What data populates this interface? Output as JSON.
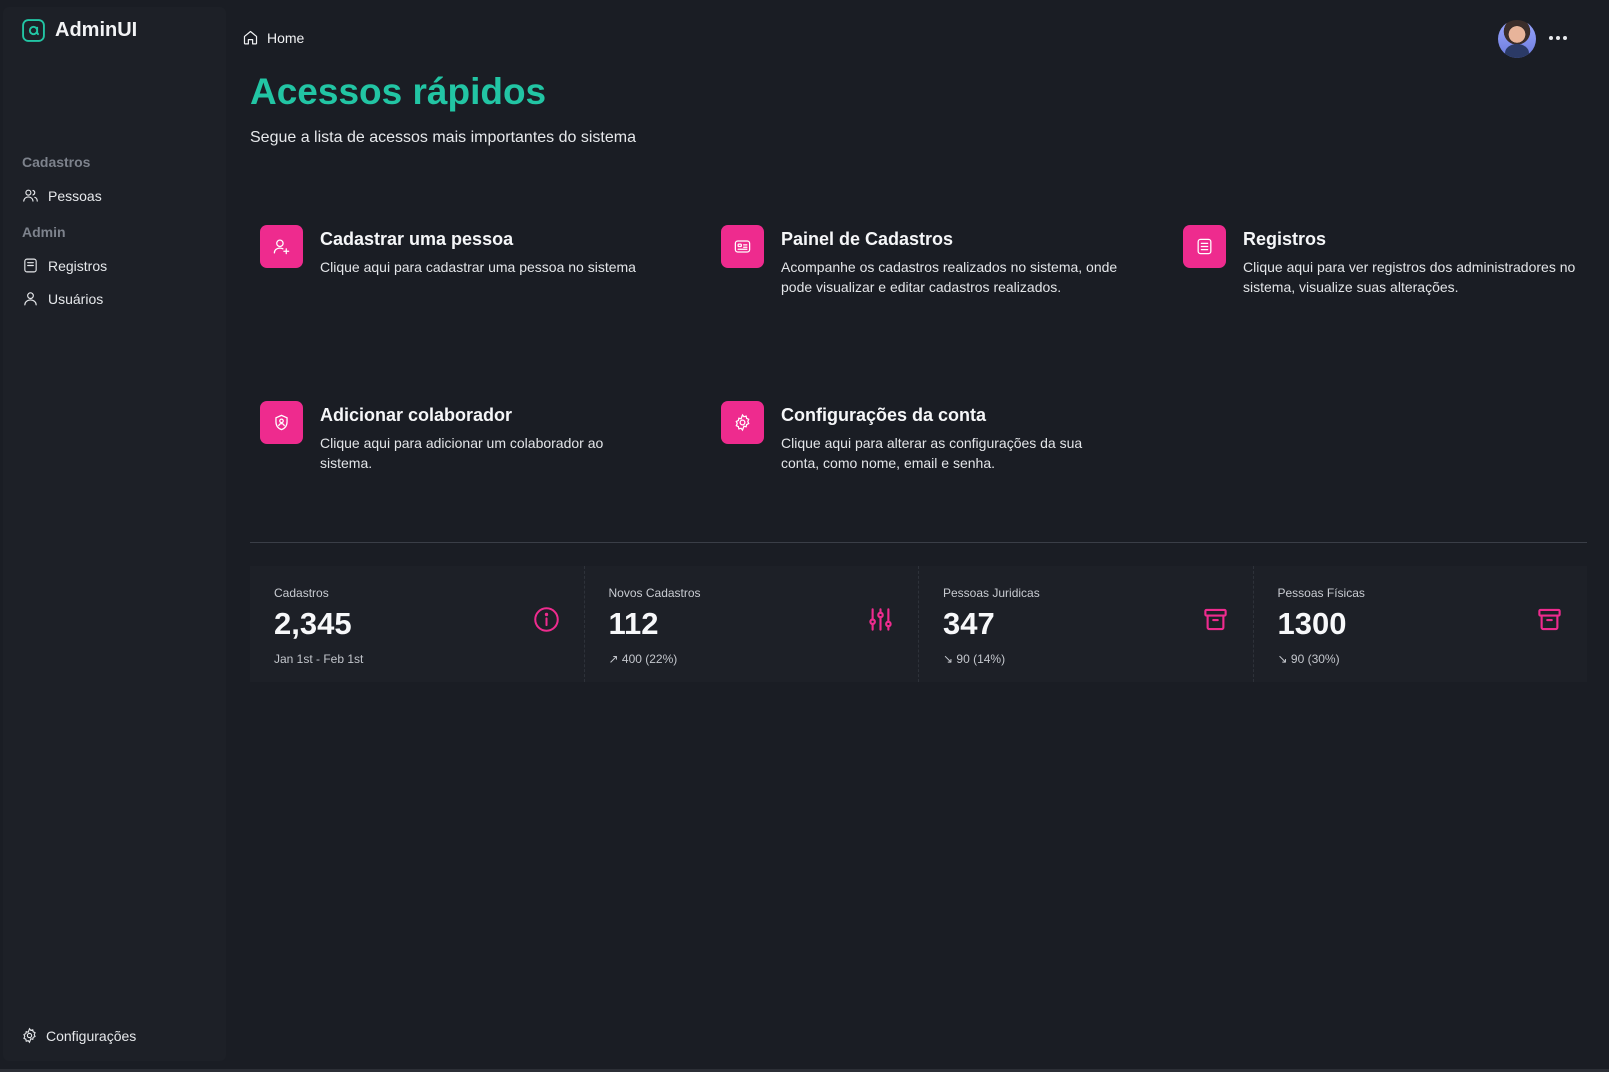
{
  "app": {
    "name": "AdminUI"
  },
  "colors": {
    "accent_teal": "#22c5a4",
    "accent_pink": "#ee2b8e",
    "background": "#1a1d24"
  },
  "sidebar": {
    "sections": [
      {
        "title": "Cadastros",
        "items": [
          {
            "label": "Pessoas",
            "icon": "users-icon"
          }
        ]
      },
      {
        "title": "Admin",
        "items": [
          {
            "label": "Registros",
            "icon": "file-icon"
          },
          {
            "label": "Usuários",
            "icon": "user-icon"
          }
        ]
      }
    ],
    "footer": {
      "label": "Configurações",
      "icon": "gear-icon"
    }
  },
  "header": {
    "breadcrumb": "Home"
  },
  "main": {
    "title": "Acessos rápidos",
    "subtitle": "Segue a lista de acessos mais importantes do sistema",
    "cards": [
      {
        "title": "Cadastrar uma pessoa",
        "description": "Clique aqui para cadastrar uma pessoa no sistema",
        "icon": "user-plus-icon"
      },
      {
        "title": "Painel de Cadastros",
        "description": "Acompanhe os cadastros realizados no sistema, onde pode visualizar e editar cadastros realizados.",
        "icon": "id-card-icon"
      },
      {
        "title": "Registros",
        "description": "Clique aqui para ver registros dos administradores no sistema, visualize suas alterações.",
        "icon": "list-icon"
      },
      {
        "title": "Adicionar colaborador",
        "description": "Clique aqui para adicionar um colaborador ao sistema.",
        "icon": "user-shield-icon"
      },
      {
        "title": "Configurações da conta",
        "description": "Clique aqui para alterar as configurações da sua conta, como nome, email e senha.",
        "icon": "gear-icon"
      }
    ]
  },
  "stats": [
    {
      "label": "Cadastros",
      "value": "2,345",
      "description": "Jan 1st - Feb 1st",
      "icon": "info-icon"
    },
    {
      "label": "Novos Cadastros",
      "value": "112",
      "description": "↗︎ 400 (22%)",
      "icon": "sliders-icon"
    },
    {
      "label": "Pessoas Juridicas",
      "value": "347",
      "description": "↘︎ 90 (14%)",
      "icon": "archive-icon"
    },
    {
      "label": "Pessoas Físicas",
      "value": "1300",
      "description": "↘︎ 90 (30%)",
      "icon": "archive-icon"
    }
  ]
}
